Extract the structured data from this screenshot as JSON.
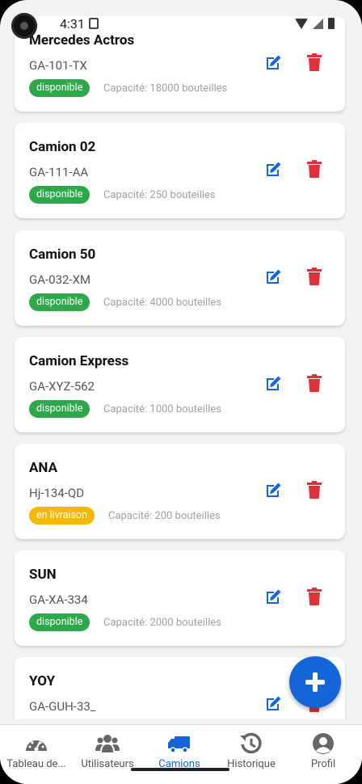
{
  "status_bar": {
    "time": "4:31"
  },
  "trucks": [
    {
      "name": "Mercedes Actros",
      "plate": "GA-101-TX",
      "status": "disponible",
      "status_color": "#2ea84a",
      "capacity": "Capacité: 18000 bouteilles"
    },
    {
      "name": "Camion 02",
      "plate": "GA-111-AA",
      "status": "disponible",
      "status_color": "#2ea84a",
      "capacity": "Capacité: 250 bouteilles"
    },
    {
      "name": "Camion 50",
      "plate": "GA-032-XM",
      "status": "disponible",
      "status_color": "#2ea84a",
      "capacity": "Capacité: 4000 bouteilles"
    },
    {
      "name": "Camion Express",
      "plate": "GA-XYZ-562",
      "status": "disponible",
      "status_color": "#2ea84a",
      "capacity": "Capacité: 1000 bouteilles"
    },
    {
      "name": "ANA",
      "plate": "Hj-134-QD",
      "status": "en livraison",
      "status_color": "#f5b800",
      "capacity": "Capacité: 200 bouteilles"
    },
    {
      "name": "SUN",
      "plate": "GA-XA-334",
      "status": "disponible",
      "status_color": "#2ea84a",
      "capacity": "Capacité: 2000 bouteilles"
    },
    {
      "name": "YOY",
      "plate": "GA-GUH-33_",
      "status": "",
      "status_color": "",
      "capacity": ""
    }
  ],
  "colors": {
    "primary": "#1565d8",
    "delete": "#e0313a",
    "available": "#2ea84a",
    "in_delivery": "#f5b800"
  },
  "fab": {
    "icon": "plus-icon"
  },
  "nav": [
    {
      "label": "Tableau de...",
      "icon": "dashboard-icon"
    },
    {
      "label": "Utilisateurs",
      "icon": "users-icon"
    },
    {
      "label": "Camions",
      "icon": "truck-icon",
      "active": true
    },
    {
      "label": "Historique",
      "icon": "history-icon"
    },
    {
      "label": "Profil",
      "icon": "profile-icon"
    }
  ]
}
